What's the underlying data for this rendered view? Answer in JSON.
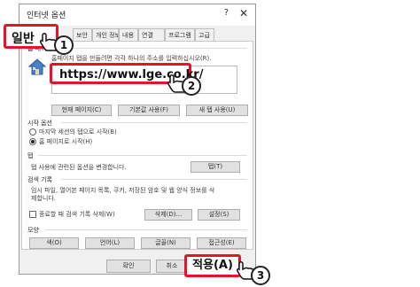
{
  "dialog": {
    "title": "인터넷 옵션",
    "help_glyph": "?",
    "close_glyph": "✕",
    "tabs": {
      "general": "일반",
      "security": "보안",
      "privacy": "개인 정보",
      "content": "내용",
      "connections": "연결",
      "programs": "프로그램",
      "advanced": "고급"
    },
    "homepage": {
      "section": "홈 페이지",
      "description": "홈페이지 탭을 만들려면 각각 하나의 주소를 입력하십시오(R).",
      "url": "https://www.lge.co.kr/",
      "use_current": "현재 페이지(C)",
      "use_default": "기본값 사용(F)",
      "use_new_tab": "새 탭 사용(U)"
    },
    "startup": {
      "section": "시작 옵션",
      "option_last_session": "마지막 세션의 탭으로 시작(B)",
      "option_homepage": "홈 페이지로 시작(H)"
    },
    "tabs_section": {
      "section": "탭",
      "description": "탭 사용에 관련된 옵션을 변경합니다.",
      "button": "탭(T)"
    },
    "history": {
      "section": "검색 기록",
      "description_line1": "임시 파일, 열어본 페이지 목록, 쿠키, 저장된 암호 및 웹 양식 정보를 삭",
      "description_line2": "제합니다.",
      "delete_on_exit": "종료할 때 검색 기록 삭제(W)",
      "delete_button": "삭제(D)...",
      "settings_button": "설정(S)"
    },
    "appearance": {
      "section": "모양",
      "colors": "색(O)",
      "languages": "언어(L)",
      "fonts": "글꼴(N)",
      "accessibility": "접근성(E)"
    },
    "footer": {
      "ok": "확인",
      "cancel": "취소",
      "apply": "적용(A)"
    }
  },
  "callouts": [
    "1",
    "2",
    "3"
  ],
  "colors": {
    "highlight": "#e8132b",
    "dialog_bg": "#f0f0f0",
    "button_bg": "#e1e1e1"
  },
  "icons": [
    "house-icon",
    "hand-cursor-icon"
  ]
}
